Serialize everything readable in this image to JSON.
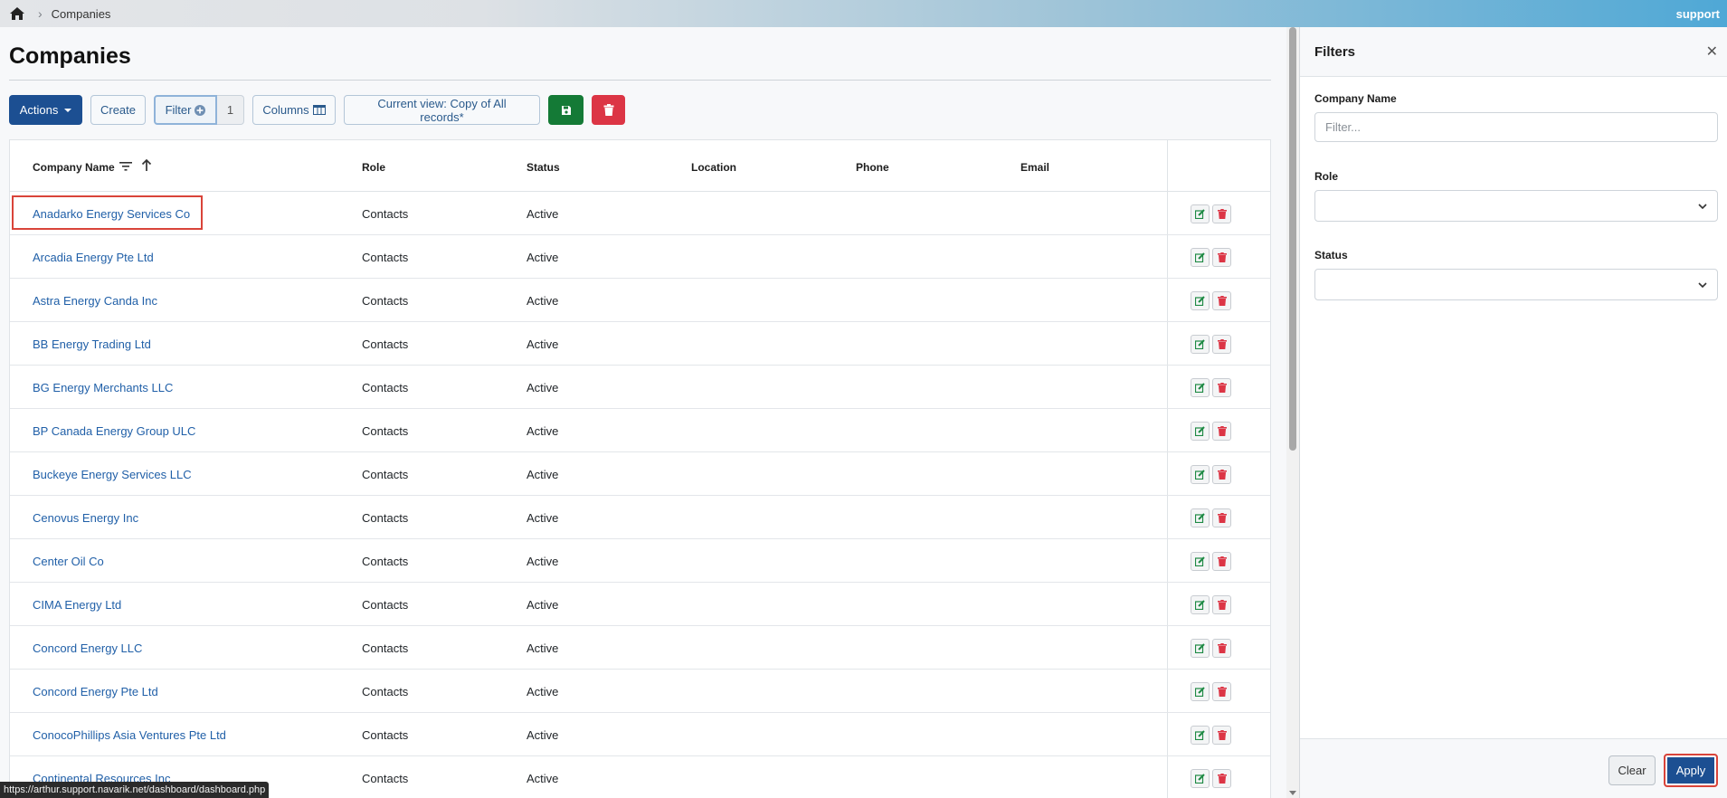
{
  "breadcrumb": {
    "current": "Companies"
  },
  "brand": "support",
  "page_title": "Companies",
  "toolbar": {
    "actions_label": "Actions",
    "create_label": "Create",
    "filter_label": "Filter",
    "filter_count": "1",
    "columns_label": "Columns",
    "current_view_label": "Current view: Copy of All records*"
  },
  "table": {
    "columns": [
      "Company Name",
      "Role",
      "Status",
      "Location",
      "Phone",
      "Email"
    ],
    "rows": [
      {
        "name": "Anadarko Energy Services Co",
        "role": "Contacts",
        "status": "Active"
      },
      {
        "name": "Arcadia Energy Pte Ltd",
        "role": "Contacts",
        "status": "Active"
      },
      {
        "name": "Astra Energy Canda Inc",
        "role": "Contacts",
        "status": "Active"
      },
      {
        "name": "BB Energy Trading Ltd",
        "role": "Contacts",
        "status": "Active"
      },
      {
        "name": "BG Energy Merchants LLC",
        "role": "Contacts",
        "status": "Active"
      },
      {
        "name": "BP Canada Energy Group ULC",
        "role": "Contacts",
        "status": "Active"
      },
      {
        "name": "Buckeye Energy Services LLC",
        "role": "Contacts",
        "status": "Active"
      },
      {
        "name": "Cenovus Energy Inc",
        "role": "Contacts",
        "status": "Active"
      },
      {
        "name": "Center Oil Co",
        "role": "Contacts",
        "status": "Active"
      },
      {
        "name": "CIMA Energy Ltd",
        "role": "Contacts",
        "status": "Active"
      },
      {
        "name": "Concord Energy LLC",
        "role": "Contacts",
        "status": "Active"
      },
      {
        "name": "Concord Energy Pte Ltd",
        "role": "Contacts",
        "status": "Active"
      },
      {
        "name": "ConocoPhillips Asia Ventures Pte Ltd",
        "role": "Contacts",
        "status": "Active"
      },
      {
        "name": "Continental Resources Inc",
        "role": "Contacts",
        "status": "Active"
      }
    ]
  },
  "filters_panel": {
    "title": "Filters",
    "company_name_label": "Company Name",
    "company_name_placeholder": "Filter...",
    "company_name_value": "",
    "role_label": "Role",
    "role_value": "",
    "status_label": "Status",
    "status_value": "",
    "clear_label": "Clear",
    "apply_label": "Apply"
  },
  "status_url": "https://arthur.support.navarik.net/dashboard/dashboard.php",
  "colors": {
    "primary": "#1c4f92",
    "success": "#147a36",
    "danger": "#dc3545",
    "link": "#2160a8",
    "highlight": "#d9443a"
  }
}
